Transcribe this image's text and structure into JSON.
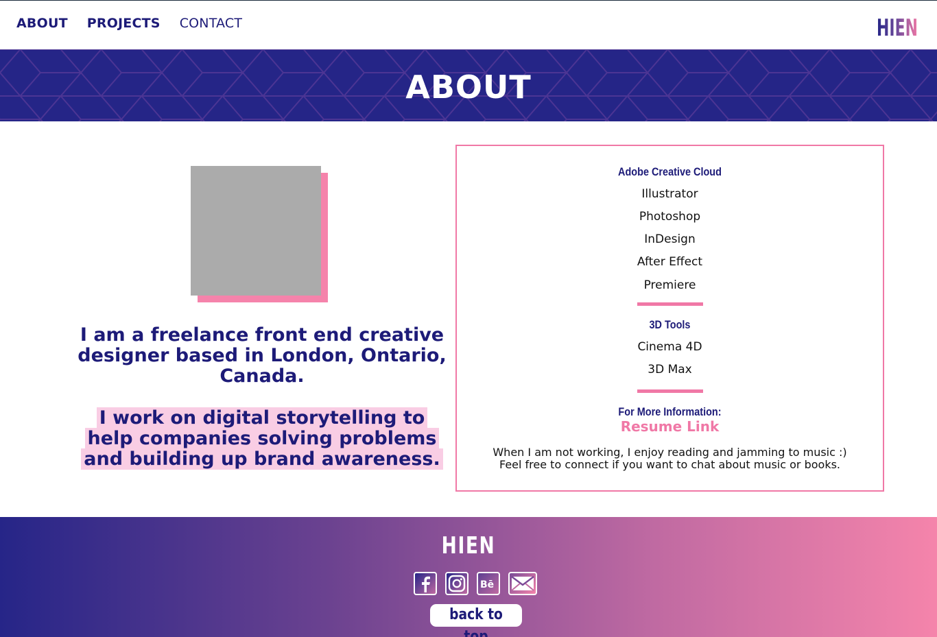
{
  "nav": {
    "items": [
      {
        "label": "ABOUT"
      },
      {
        "label": "PROJECTS"
      },
      {
        "label": "CONTACT"
      }
    ],
    "logo_text": "HIEN"
  },
  "hero": {
    "title": "ABOUT"
  },
  "profile": {
    "intro": "I am a freelance front end creative designer based in London, Ontario, Canada.",
    "mission": "I work on digital storytelling to help companies solving problems and building up brand awareness."
  },
  "skills": {
    "adobe": {
      "title": "Adobe Creative Cloud",
      "items": [
        "Illustrator",
        "Photoshop",
        "InDesign",
        "After Effect",
        "Premiere"
      ]
    },
    "tools3d": {
      "title": "3D Tools",
      "items": [
        "Cinema 4D",
        "3D Max"
      ]
    },
    "more_info_label": "For More Information:",
    "resume_link": "Resume Link",
    "note_line1": "When I am not working, I enjoy reading and jamming to music :)",
    "note_line2": "Feel free to connect if you want to chat about music or books."
  },
  "footer": {
    "logo_text": "HIEN",
    "socials": [
      {
        "icon": "facebook-icon"
      },
      {
        "icon": "instagram-icon"
      },
      {
        "icon": "behance-icon"
      },
      {
        "icon": "mail-icon"
      }
    ],
    "back_to_top": "back to top"
  },
  "colors": {
    "navy": "#252587",
    "pink": "#f078a6",
    "highlight": "#f9cde4"
  }
}
